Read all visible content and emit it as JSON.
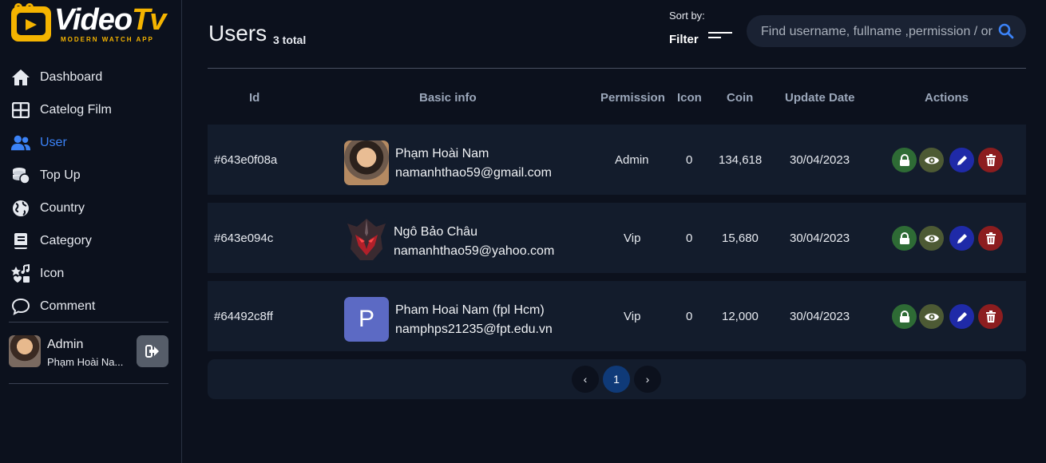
{
  "brand": {
    "name_main": "Video",
    "name_accent": "Tv",
    "tagline": "MODERN WATCH APP"
  },
  "nav": [
    {
      "label": "Dashboard",
      "icon": "home-icon",
      "active": false
    },
    {
      "label": "Catelog Film",
      "icon": "grid-icon",
      "active": false
    },
    {
      "label": "User",
      "icon": "users-icon",
      "active": true
    },
    {
      "label": "Top Up",
      "icon": "coins-icon",
      "active": false
    },
    {
      "label": "Country",
      "icon": "globe-icon",
      "active": false
    },
    {
      "label": "Category",
      "icon": "book-icon",
      "active": false
    },
    {
      "label": "Icon",
      "icon": "icons-icon",
      "active": false
    },
    {
      "label": "Comment",
      "icon": "comment-icon",
      "active": false
    }
  ],
  "profile": {
    "role": "Admin",
    "name": "Phạm Hoài Na..."
  },
  "header": {
    "title": "Users",
    "count": "3 total",
    "sort_label": "Sort by:",
    "filter_label": "Filter",
    "search_placeholder": "Find username, fullname ,permission / or"
  },
  "table": {
    "columns": [
      "Id",
      "Basic info",
      "Permission",
      "Icon",
      "Coin",
      "Update Date",
      "Actions"
    ],
    "rows": [
      {
        "id": "#643e0f08a",
        "name": "Phạm Hoài Nam",
        "email": "namanhthao59@gmail.com",
        "permission": "Admin",
        "icon": "0",
        "coin": "134,618",
        "update_date": "30/04/2023",
        "avatar": "photo"
      },
      {
        "id": "#643e094c",
        "name": "Ngô Bảo Châu",
        "email": "namanhthao59@yahoo.com",
        "permission": "Vip",
        "icon": "0",
        "coin": "15,680",
        "update_date": "30/04/2023",
        "avatar": "helmet"
      },
      {
        "id": "#64492c8ff",
        "name": "Pham Hoai Nam (fpl Hcm)",
        "email": "namphps21235@fpt.edu.vn",
        "permission": "Vip",
        "icon": "0",
        "coin": "12,000",
        "update_date": "30/04/2023",
        "avatar": "letter",
        "avatar_letter": "P"
      }
    ]
  },
  "pagination": {
    "prev": "‹",
    "current": "1",
    "next": "›"
  },
  "colors": {
    "accent": "#3b82f6",
    "brand": "#f5b400",
    "lock": "#2e6b35",
    "view": "#4d5a34",
    "edit": "#1f2aa8",
    "delete": "#8c1d1f"
  }
}
